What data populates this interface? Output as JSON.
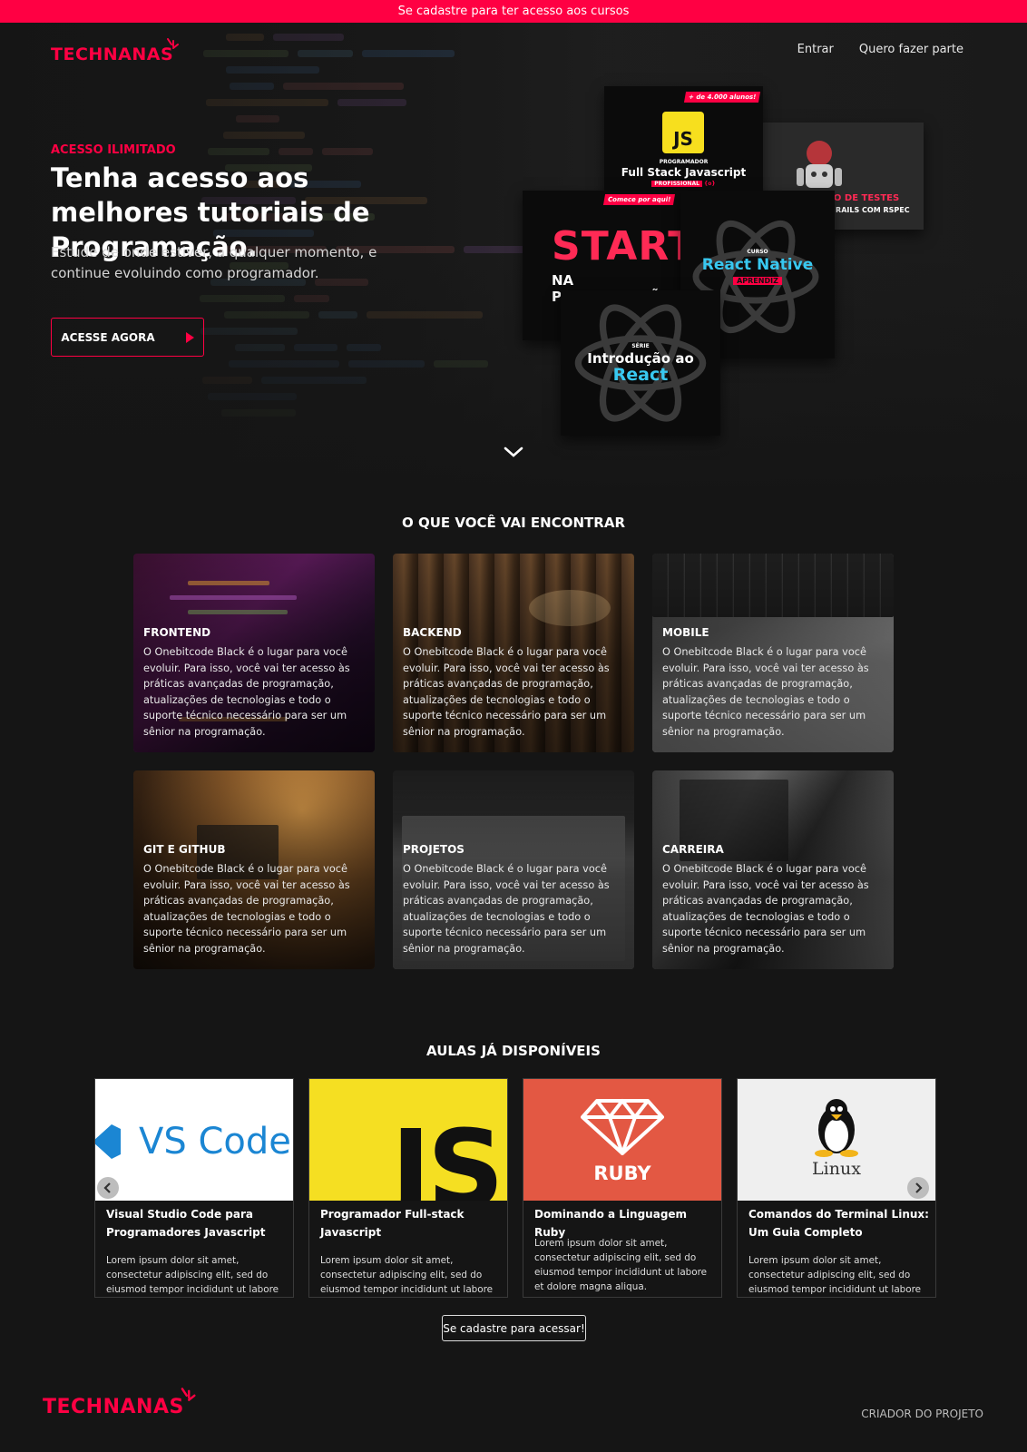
{
  "banner": {
    "text": "Se cadastre para ter acesso aos cursos"
  },
  "brand": {
    "name": "TECHNANAS",
    "accent": "#ff0043"
  },
  "nav": {
    "login": "Entrar",
    "join": "Quero fazer parte"
  },
  "hero": {
    "eyebrow": "ACESSO ILIMITADO",
    "title": "Tenha acesso aos melhores tutoriais de Programação.",
    "subtitle": "Estude de onde estiver, a qualquer momento, e continue evoluindo como programador.",
    "cta": "ACESSE AGORA",
    "covers": {
      "js": {
        "badge": "+ de 4.000 alunos!",
        "logo": "JS",
        "pre": "PROGRAMADOR",
        "title": "Full Stack Javascript",
        "tag": "PROFISSIONAL",
        "tag2": "{o}"
      },
      "ruby": {
        "title": "MINICURSO DE TESTES",
        "sub": "PARA RUBY ON RAILS COM RSPEC"
      },
      "start": {
        "badge": "Comece por aqui!",
        "big": "START",
        "small": "NA PROGRAMAÇÃO"
      },
      "rn": {
        "pre": "CURSO",
        "title": "React Native",
        "tag": "APRENDIZ"
      },
      "react": {
        "pre": "SÉRIE",
        "title": "Introdução ao",
        "title2": "React"
      }
    }
  },
  "features": {
    "title": "O QUE VOCÊ VAI ENCONTRAR",
    "items": [
      {
        "name": "FRONTEND",
        "description": "O Onebitcode Black é o lugar para você evoluir. Para isso, você vai ter acesso às práticas avançadas de programação, atualizações de tecnologias e todo o suporte técnico necessário para ser um sênior na programação."
      },
      {
        "name": "BACKEND",
        "description": "O Onebitcode Black é o lugar para você evoluir. Para isso, você vai ter acesso às práticas avançadas de programação, atualizações de tecnologias e todo o suporte técnico necessário para ser um sênior na programação."
      },
      {
        "name": "MOBILE",
        "description": "O Onebitcode Black é o lugar para você evoluir. Para isso, você vai ter acesso às práticas avançadas de programação, atualizações de tecnologias e todo o suporte técnico necessário para ser um sênior na programação."
      },
      {
        "name": "GIT E GITHUB",
        "description": "O Onebitcode Black é o lugar para você evoluir. Para isso, você vai ter acesso às práticas avançadas de programação, atualizações de tecnologias e todo o suporte técnico necessário para ser um sênior na programação."
      },
      {
        "name": "PROJETOS",
        "description": "O Onebitcode Black é o lugar para você evoluir. Para isso, você vai ter acesso às práticas avançadas de programação, atualizações de tecnologias e todo o suporte técnico necessário para ser um sênior na programação."
      },
      {
        "name": "CARREIRA",
        "description": "O Onebitcode Black é o lugar para você evoluir. Para isso, você vai ter acesso às práticas avançadas de programação, atualizações de tecnologias e todo o suporte técnico necessário para ser um sênior na programação."
      }
    ]
  },
  "lessons": {
    "title": "AULAS JÁ DISPONÍVEIS",
    "items": [
      {
        "thumb_text": "VS Code",
        "title": "Visual Studio Code para Programadores Javascript",
        "description": "Lorem ipsum dolor sit amet, consectetur adipiscing elit, sed do eiusmod tempor incididunt ut labore et"
      },
      {
        "thumb_text": "JS",
        "title": "Programador Full-stack Javascript",
        "description": "Lorem ipsum dolor sit amet, consectetur adipiscing elit, sed do eiusmod tempor incididunt ut labore et"
      },
      {
        "thumb_text": "RUBY",
        "title": "Dominando a Linguagem Ruby",
        "description": "Lorem ipsum dolor sit amet, consectetur adipiscing elit, sed do eiusmod tempor incididunt ut labore et dolore magna aliqua."
      },
      {
        "thumb_text": "Linux",
        "title": "Comandos do Terminal Linux: Um Guia Completo",
        "description": "Lorem ipsum dolor sit amet, consectetur adipiscing elit, sed do eiusmod tempor incididunt ut labore et"
      }
    ],
    "signup_button": "Se cadastre para acessar!"
  },
  "footer": {
    "creator_link": "CRIADOR DO PROJETO"
  }
}
